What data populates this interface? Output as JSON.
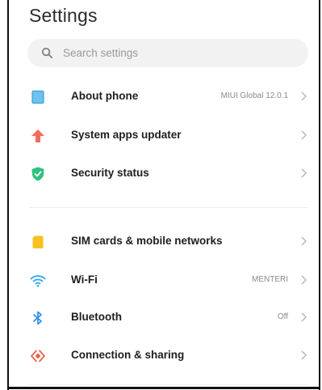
{
  "header": {
    "title": "Settings"
  },
  "search": {
    "placeholder": "Search settings"
  },
  "items": [
    {
      "label": "About phone",
      "value": "MIUI Global 12.0.1",
      "icon": "phone-square-icon",
      "color": "#4fb1ea"
    },
    {
      "label": "System apps updater",
      "value": "",
      "icon": "arrow-up-icon",
      "color": "#f26b5b"
    },
    {
      "label": "Security status",
      "value": "",
      "icon": "shield-check-icon",
      "color": "#2ec27e"
    },
    {
      "label": "SIM cards & mobile networks",
      "value": "",
      "icon": "sim-card-icon",
      "color": "#f7c122"
    },
    {
      "label": "Wi-Fi",
      "value": "MENTERI",
      "icon": "wifi-icon",
      "color": "#2aa4ef"
    },
    {
      "label": "Bluetooth",
      "value": "Off",
      "icon": "bluetooth-icon",
      "color": "#2f8fe8"
    },
    {
      "label": "Connection & sharing",
      "value": "",
      "icon": "connection-sharing-icon",
      "color": "#e8634c"
    }
  ]
}
